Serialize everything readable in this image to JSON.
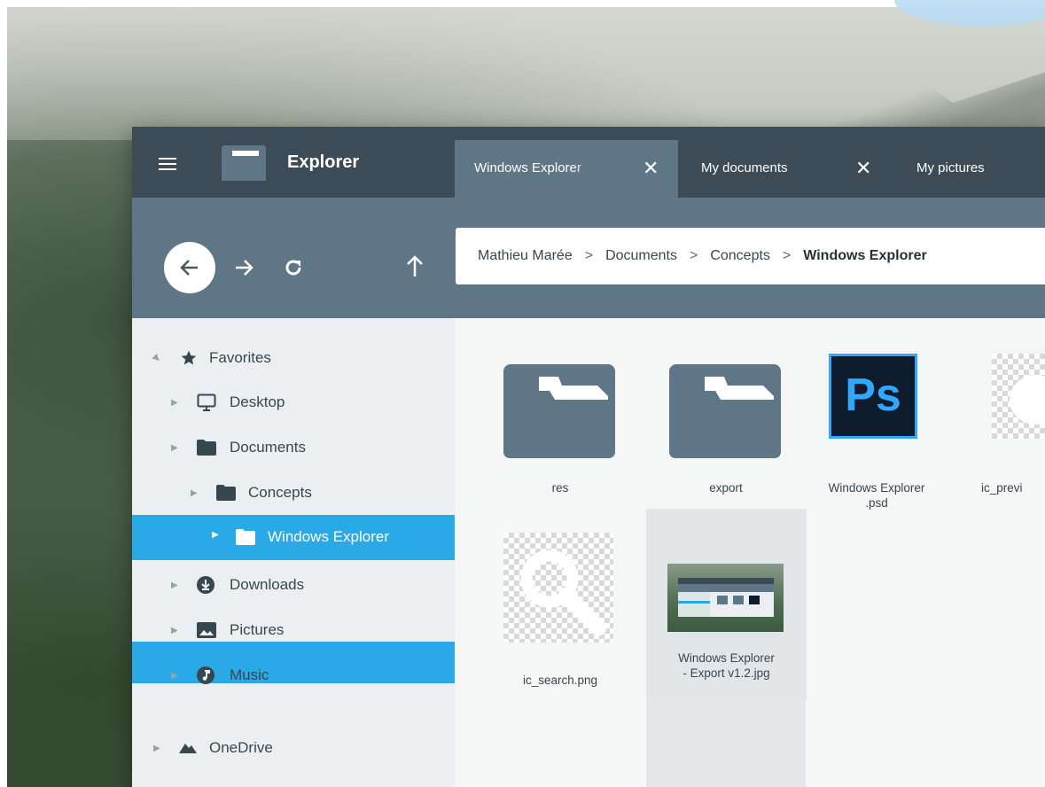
{
  "app": {
    "title": "Explorer"
  },
  "tabs": [
    {
      "label": "Windows Explorer",
      "close": "✕"
    },
    {
      "label": "My documents",
      "close": "✕"
    },
    {
      "label": "My pictures"
    }
  ],
  "nav": {
    "back_icon": "arrow-left-icon",
    "forward_icon": "arrow-right-icon",
    "refresh_icon": "refresh-icon",
    "up_icon": "arrow-up-icon"
  },
  "breadcrumb": {
    "items": [
      "Mathieu Marée",
      "Documents",
      "Concepts",
      "Windows Explorer"
    ],
    "separator": ">"
  },
  "sidebar": {
    "items": [
      {
        "label": "Favorites",
        "icon": "star-icon"
      },
      {
        "label": "Desktop",
        "icon": "monitor-icon"
      },
      {
        "label": "Documents",
        "icon": "folder-icon"
      },
      {
        "label": "Concepts",
        "icon": "folder-icon"
      },
      {
        "label": "Windows Explorer",
        "icon": "folder-icon",
        "selected": true
      },
      {
        "label": "Downloads",
        "icon": "download-icon"
      },
      {
        "label": "Pictures",
        "icon": "image-icon"
      },
      {
        "label": "Music",
        "icon": "music-icon"
      },
      {
        "label": "OneDrive",
        "icon": "cloud-icon"
      }
    ]
  },
  "files": [
    {
      "name": "res",
      "type": "folder"
    },
    {
      "name": "export",
      "type": "folder"
    },
    {
      "name_line1": "Windows Explorer",
      "name_line2": ".psd",
      "type": "psd",
      "badge": "Ps"
    },
    {
      "name": "ic_previ",
      "type": "png"
    },
    {
      "name": "ic_search.png",
      "type": "png"
    },
    {
      "name_line1": "Windows Explorer",
      "name_line2": "- Export v1.2.jpg",
      "type": "jpg",
      "selected": true
    }
  ],
  "colors": {
    "titlebar": "#3c4b56",
    "navbar": "#5e7685",
    "accent": "#29a9e6",
    "sidebar": "#eceff1",
    "content": "#f5f6f6"
  }
}
